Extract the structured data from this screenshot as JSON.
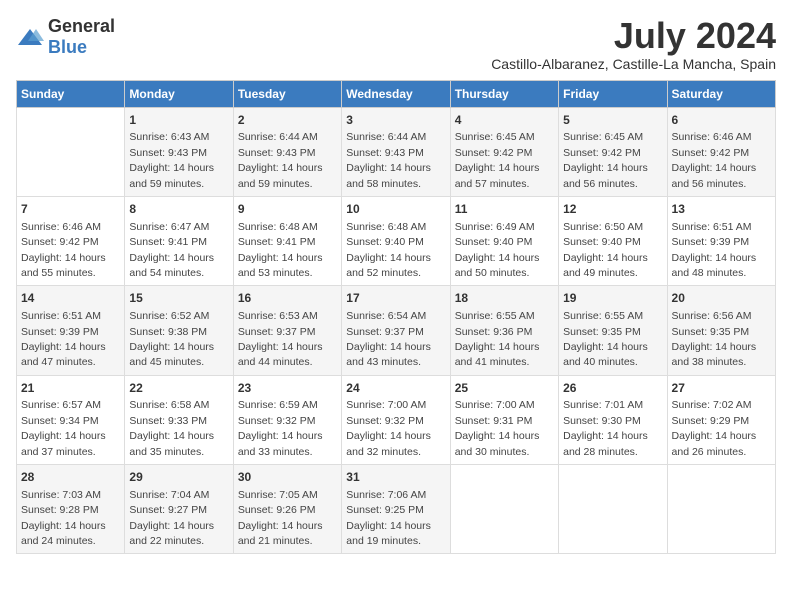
{
  "logo": {
    "general": "General",
    "blue": "Blue"
  },
  "title": "July 2024",
  "subtitle": "Castillo-Albaranez, Castille-La Mancha, Spain",
  "days_of_week": [
    "Sunday",
    "Monday",
    "Tuesday",
    "Wednesday",
    "Thursday",
    "Friday",
    "Saturday"
  ],
  "weeks": [
    [
      {
        "day": "",
        "info": ""
      },
      {
        "day": "1",
        "info": "Sunrise: 6:43 AM\nSunset: 9:43 PM\nDaylight: 14 hours\nand 59 minutes."
      },
      {
        "day": "2",
        "info": "Sunrise: 6:44 AM\nSunset: 9:43 PM\nDaylight: 14 hours\nand 59 minutes."
      },
      {
        "day": "3",
        "info": "Sunrise: 6:44 AM\nSunset: 9:43 PM\nDaylight: 14 hours\nand 58 minutes."
      },
      {
        "day": "4",
        "info": "Sunrise: 6:45 AM\nSunset: 9:42 PM\nDaylight: 14 hours\nand 57 minutes."
      },
      {
        "day": "5",
        "info": "Sunrise: 6:45 AM\nSunset: 9:42 PM\nDaylight: 14 hours\nand 56 minutes."
      },
      {
        "day": "6",
        "info": "Sunrise: 6:46 AM\nSunset: 9:42 PM\nDaylight: 14 hours\nand 56 minutes."
      }
    ],
    [
      {
        "day": "7",
        "info": "Sunrise: 6:46 AM\nSunset: 9:42 PM\nDaylight: 14 hours\nand 55 minutes."
      },
      {
        "day": "8",
        "info": "Sunrise: 6:47 AM\nSunset: 9:41 PM\nDaylight: 14 hours\nand 54 minutes."
      },
      {
        "day": "9",
        "info": "Sunrise: 6:48 AM\nSunset: 9:41 PM\nDaylight: 14 hours\nand 53 minutes."
      },
      {
        "day": "10",
        "info": "Sunrise: 6:48 AM\nSunset: 9:40 PM\nDaylight: 14 hours\nand 52 minutes."
      },
      {
        "day": "11",
        "info": "Sunrise: 6:49 AM\nSunset: 9:40 PM\nDaylight: 14 hours\nand 50 minutes."
      },
      {
        "day": "12",
        "info": "Sunrise: 6:50 AM\nSunset: 9:40 PM\nDaylight: 14 hours\nand 49 minutes."
      },
      {
        "day": "13",
        "info": "Sunrise: 6:51 AM\nSunset: 9:39 PM\nDaylight: 14 hours\nand 48 minutes."
      }
    ],
    [
      {
        "day": "14",
        "info": "Sunrise: 6:51 AM\nSunset: 9:39 PM\nDaylight: 14 hours\nand 47 minutes."
      },
      {
        "day": "15",
        "info": "Sunrise: 6:52 AM\nSunset: 9:38 PM\nDaylight: 14 hours\nand 45 minutes."
      },
      {
        "day": "16",
        "info": "Sunrise: 6:53 AM\nSunset: 9:37 PM\nDaylight: 14 hours\nand 44 minutes."
      },
      {
        "day": "17",
        "info": "Sunrise: 6:54 AM\nSunset: 9:37 PM\nDaylight: 14 hours\nand 43 minutes."
      },
      {
        "day": "18",
        "info": "Sunrise: 6:55 AM\nSunset: 9:36 PM\nDaylight: 14 hours\nand 41 minutes."
      },
      {
        "day": "19",
        "info": "Sunrise: 6:55 AM\nSunset: 9:35 PM\nDaylight: 14 hours\nand 40 minutes."
      },
      {
        "day": "20",
        "info": "Sunrise: 6:56 AM\nSunset: 9:35 PM\nDaylight: 14 hours\nand 38 minutes."
      }
    ],
    [
      {
        "day": "21",
        "info": "Sunrise: 6:57 AM\nSunset: 9:34 PM\nDaylight: 14 hours\nand 37 minutes."
      },
      {
        "day": "22",
        "info": "Sunrise: 6:58 AM\nSunset: 9:33 PM\nDaylight: 14 hours\nand 35 minutes."
      },
      {
        "day": "23",
        "info": "Sunrise: 6:59 AM\nSunset: 9:32 PM\nDaylight: 14 hours\nand 33 minutes."
      },
      {
        "day": "24",
        "info": "Sunrise: 7:00 AM\nSunset: 9:32 PM\nDaylight: 14 hours\nand 32 minutes."
      },
      {
        "day": "25",
        "info": "Sunrise: 7:00 AM\nSunset: 9:31 PM\nDaylight: 14 hours\nand 30 minutes."
      },
      {
        "day": "26",
        "info": "Sunrise: 7:01 AM\nSunset: 9:30 PM\nDaylight: 14 hours\nand 28 minutes."
      },
      {
        "day": "27",
        "info": "Sunrise: 7:02 AM\nSunset: 9:29 PM\nDaylight: 14 hours\nand 26 minutes."
      }
    ],
    [
      {
        "day": "28",
        "info": "Sunrise: 7:03 AM\nSunset: 9:28 PM\nDaylight: 14 hours\nand 24 minutes."
      },
      {
        "day": "29",
        "info": "Sunrise: 7:04 AM\nSunset: 9:27 PM\nDaylight: 14 hours\nand 22 minutes."
      },
      {
        "day": "30",
        "info": "Sunrise: 7:05 AM\nSunset: 9:26 PM\nDaylight: 14 hours\nand 21 minutes."
      },
      {
        "day": "31",
        "info": "Sunrise: 7:06 AM\nSunset: 9:25 PM\nDaylight: 14 hours\nand 19 minutes."
      },
      {
        "day": "",
        "info": ""
      },
      {
        "day": "",
        "info": ""
      },
      {
        "day": "",
        "info": ""
      }
    ]
  ]
}
